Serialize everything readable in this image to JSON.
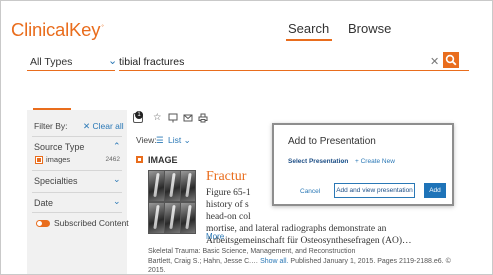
{
  "brand": {
    "logo_text": "ClinicalKey",
    "logo_mark": "°",
    "accent": "#e96d1d",
    "link": "#2a78b6"
  },
  "nav": {
    "search_label": "Search",
    "browse_label": "Browse"
  },
  "search": {
    "type_value": "All Types",
    "query": "tibial fractures"
  },
  "sidebar": {
    "filter_by": "Filter By:",
    "clear_all": "Clear all",
    "source_type": "Source Type",
    "images_label": "images",
    "images_count": "2462",
    "specialties": "Specialties",
    "date": "Date",
    "subscribed": "Subscribed Content"
  },
  "toolbar": {
    "selected_count": "1",
    "view_label": "View:",
    "view_value": "List"
  },
  "result": {
    "type_label": "IMAGE",
    "title": "Fractur",
    "text_lines": [
      "Figure 65-1",
      "history of s",
      "head-on col",
      "mortise, and lateral radiographs demonstrate an",
      "Arbeitsgemeinschaft für Osteosynthesefragen (AO)…"
    ],
    "more": "More",
    "source": "Skeletal Trauma: Basic Science, Management, and Reconstruction",
    "authors": "Bartlett, Craig S.; Hahn, Jesse C.…",
    "show_all": "Show all.",
    "published": "Published January 1, 2015. Pages 2119-2188.e6. ©",
    "year": "2015."
  },
  "popup": {
    "title": "Add to Presentation",
    "select_label": "Select Presentation",
    "create_new": "+ Create New",
    "cancel": "Cancel",
    "add_and_view": "Add and view presentation",
    "add": "Add"
  }
}
